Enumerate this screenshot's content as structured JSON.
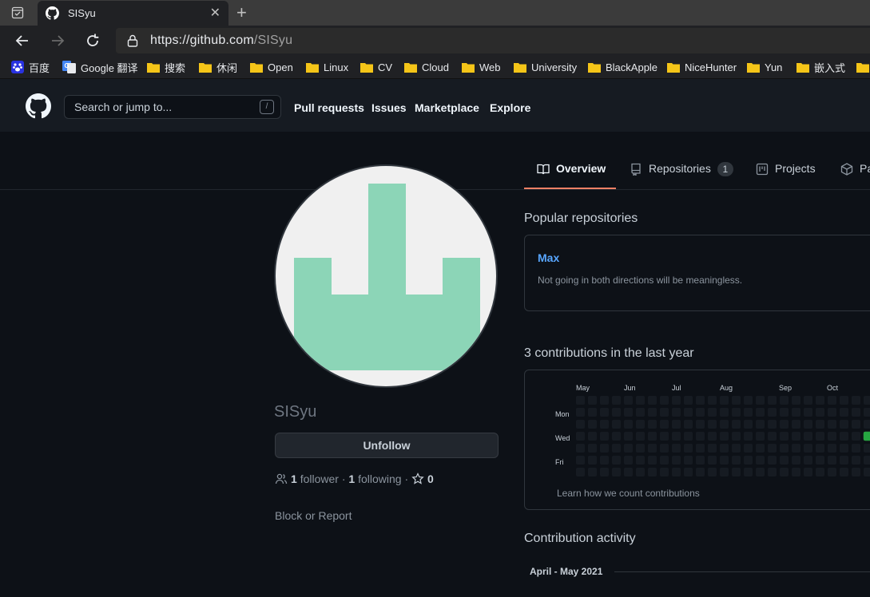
{
  "browser": {
    "tab_title": "SISyu",
    "url_host": "https://github.com",
    "url_path": "/SISyu",
    "bookmarks": [
      "百度",
      "Google 翻译",
      "搜索",
      "休闲",
      "Open",
      "Linux",
      "CV",
      "Cloud",
      "Web",
      "University",
      "BlackApple",
      "NiceHunter",
      "Yun",
      "嵌入式"
    ]
  },
  "header": {
    "search_placeholder": "Search or jump to...",
    "search_shortcut": "/",
    "nav": [
      "Pull requests",
      "Issues",
      "Marketplace",
      "Explore"
    ]
  },
  "profile": {
    "username": "SISyu",
    "unfollow_label": "Unfollow",
    "followers_count": "1",
    "followers_label": "follower",
    "following_count": "1",
    "following_label": "following",
    "stars_count": "0",
    "block_label": "Block or Report"
  },
  "tabs": [
    {
      "label": "Overview",
      "active": true
    },
    {
      "label": "Repositories",
      "count": "1"
    },
    {
      "label": "Projects"
    },
    {
      "label": "Pa"
    }
  ],
  "popular": {
    "title": "Popular repositories",
    "repos": [
      {
        "name": "Max",
        "description": "Not going in both directions will be meaningless."
      }
    ]
  },
  "contributions": {
    "title": "3 contributions in the last year",
    "months": [
      "May",
      "Jun",
      "Jul",
      "Aug",
      "Sep",
      "Oct"
    ],
    "weekdays": [
      "Mon",
      "Wed",
      "Fri"
    ],
    "highlight": {
      "week": 24,
      "day": 3,
      "level": 2
    },
    "learn_link": "Learn how we count contributions"
  },
  "activity": {
    "title": "Contribution activity",
    "month": "April - May 2021"
  },
  "colors": {
    "accent": "#f78166",
    "link": "#58a6ff",
    "contrib_green": "#26a641"
  }
}
